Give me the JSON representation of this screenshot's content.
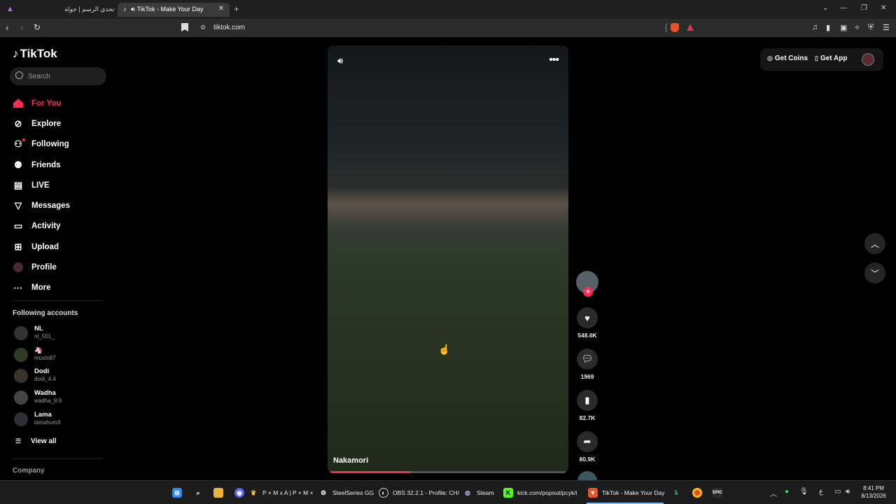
{
  "browser": {
    "tabs": [
      {
        "label": "تحدي الرسم | جولة",
        "active": false
      },
      {
        "label": "TikTok - Make Your Day",
        "active": true
      }
    ],
    "url": "tiktok.com"
  },
  "app": {
    "logo": "TikTok",
    "search_placeholder": "Search",
    "nav": [
      {
        "label": "For You",
        "icon": "home-icon",
        "active": true
      },
      {
        "label": "Explore",
        "icon": "compass-icon"
      },
      {
        "label": "Following",
        "icon": "following-icon"
      },
      {
        "label": "Friends",
        "icon": "friends-icon"
      },
      {
        "label": "LIVE",
        "icon": "live-icon"
      },
      {
        "label": "Messages",
        "icon": "messages-icon"
      },
      {
        "label": "Activity",
        "icon": "activity-icon"
      },
      {
        "label": "Upload",
        "icon": "upload-icon"
      },
      {
        "label": "Profile",
        "icon": "avatar"
      },
      {
        "label": "More",
        "icon": "more-icon"
      }
    ],
    "following_title": "Following accounts",
    "accounts": [
      {
        "name": "NL",
        "handle": "nl_501_"
      },
      {
        "name": "🦄",
        "handle": "mostn87"
      },
      {
        "name": "Dodi",
        "handle": "dodi_4.4"
      },
      {
        "name": "Wadha",
        "handle": "wadha_9.9"
      },
      {
        "name": "Lama",
        "handle": "lamahum3"
      }
    ],
    "view_all": "View all",
    "company": "Company",
    "header": {
      "get_coins": "Get Coins",
      "get_app": "Get App"
    }
  },
  "video": {
    "creator": "Nakamori",
    "progress": 0.34,
    "likes": "548.6K",
    "comments": "1969",
    "saves": "82.7K",
    "shares": "80.9K"
  },
  "taskbar": {
    "items": [
      {
        "label": "P × M x A | P × M ×"
      },
      {
        "label": "SteelSeries GG"
      },
      {
        "label": "OBS 32.2.1 - Profile: CH/"
      },
      {
        "label": "Steam"
      },
      {
        "label": "kick.com/popout/pcyk/i"
      },
      {
        "label": "TikTok - Make Your Day"
      }
    ],
    "lang": "ع",
    "time": "8:41 PM",
    "date": "8/13/2026"
  }
}
